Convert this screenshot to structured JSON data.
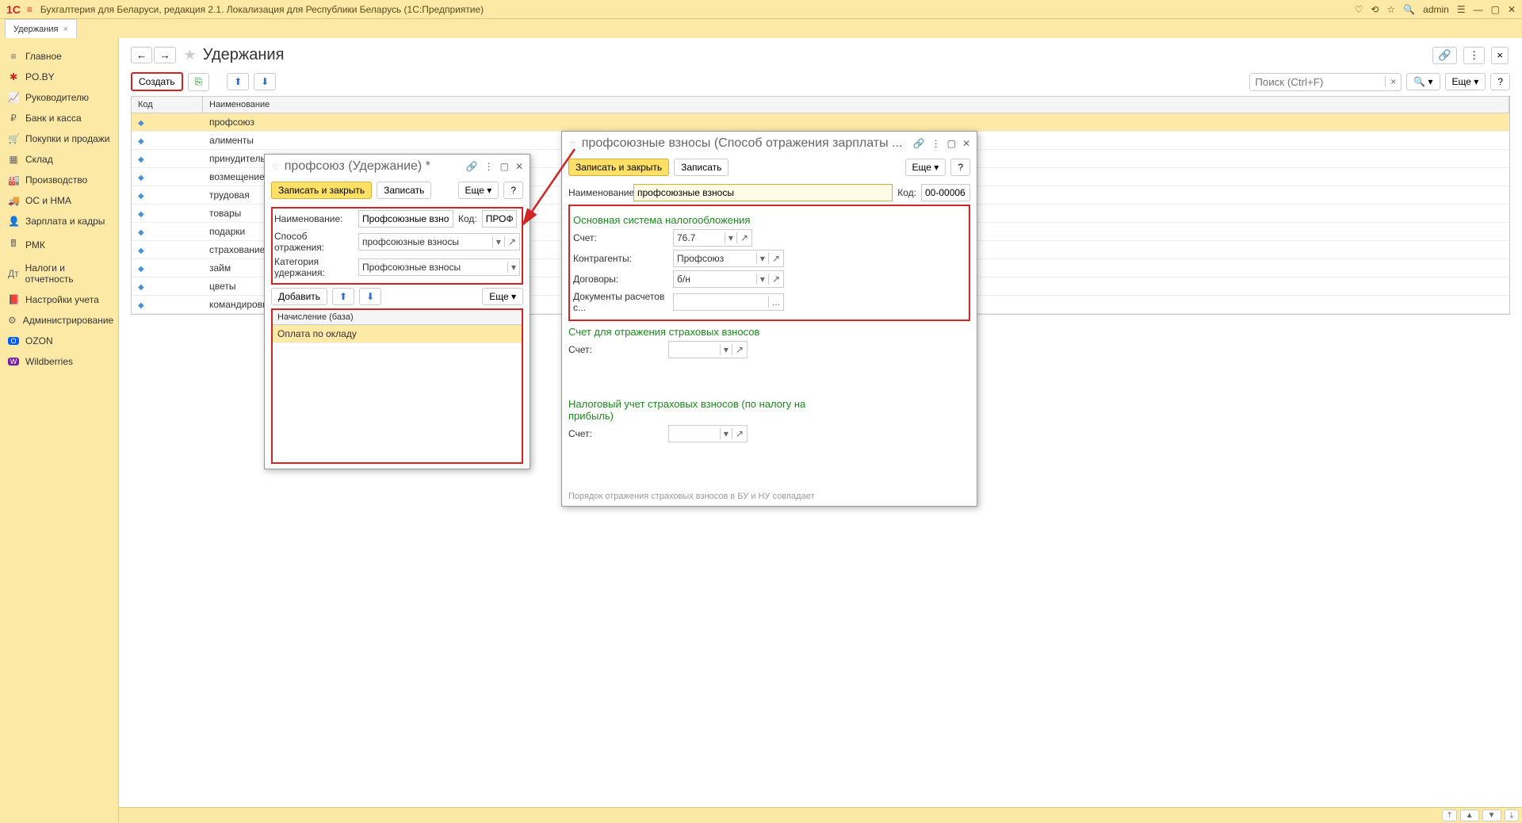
{
  "app": {
    "title": "Бухгалтерия для Беларуси, редакция 2.1. Локализация для Республики Беларусь   (1С:Предприятие)",
    "user": "admin"
  },
  "tabs": [
    {
      "label": "Удержания"
    }
  ],
  "sidebar": {
    "items": [
      {
        "label": "Главное"
      },
      {
        "label": "PO.BY"
      },
      {
        "label": "Руководителю"
      },
      {
        "label": "Банк и касса"
      },
      {
        "label": "Покупки и продажи"
      },
      {
        "label": "Склад"
      },
      {
        "label": "Производство"
      },
      {
        "label": "ОС и НМА"
      },
      {
        "label": "Зарплата и кадры"
      },
      {
        "label": "РМК"
      },
      {
        "label": "Налоги и отчетность"
      },
      {
        "label": "Настройки учета"
      },
      {
        "label": "Администрирование"
      },
      {
        "label": "OZON"
      },
      {
        "label": "Wildberries"
      }
    ]
  },
  "page": {
    "title": "Удержания",
    "create": "Создать",
    "search_placeholder": "Поиск (Ctrl+F)",
    "more": "Еще",
    "columns": {
      "code": "Код",
      "name": "Наименование"
    },
    "rows": [
      {
        "name": "профсоюз",
        "selected": true
      },
      {
        "name": "алименты"
      },
      {
        "name": "принудительный сбор"
      },
      {
        "name": "возмещение мат"
      },
      {
        "name": "трудовая"
      },
      {
        "name": "товары"
      },
      {
        "name": "подарки"
      },
      {
        "name": "страхование"
      },
      {
        "name": "займ"
      },
      {
        "name": "цветы"
      },
      {
        "name": "командировка"
      }
    ]
  },
  "dialog1": {
    "title": "профсоюз (Удержание) *",
    "save_close": "Записать и закрыть",
    "save": "Записать",
    "more": "Еще",
    "labels": {
      "name": "Наименование:",
      "code": "Код:",
      "method": "Способ отражения:",
      "category": "Категория удержания:"
    },
    "values": {
      "name": "Профсоюзные взносы",
      "code": "ПРОФ",
      "method": "профсоюзные взносы",
      "category": "Профсоюзные взносы"
    },
    "add": "Добавить",
    "base": {
      "header": "Начисление (база)",
      "rows": [
        "Оплата по окладу"
      ]
    }
  },
  "dialog2": {
    "title": "профсоюзные взносы (Способ отражения зарплаты ...",
    "save_close": "Записать и закрыть",
    "save": "Записать",
    "more": "Еще",
    "labels": {
      "name": "Наименование:",
      "code": "Код:",
      "account": "Счет:",
      "contractors": "Контрагенты:",
      "contracts": "Договоры:",
      "docs": "Документы расчетов с..."
    },
    "values": {
      "name": "профсоюзные взносы",
      "code": "00-00006",
      "account": "76.7",
      "contractors": "Профсоюз",
      "contracts": "б/н"
    },
    "sections": {
      "main": "Основная система налогообложения",
      "ins": "Счет для отражения страховых взносов",
      "tax": "Налоговый учет страховых взносов (по налогу на прибыль)"
    },
    "account_label": "Счет:",
    "hint": "Порядок отражения страховых взносов в БУ и НУ совпадает"
  }
}
